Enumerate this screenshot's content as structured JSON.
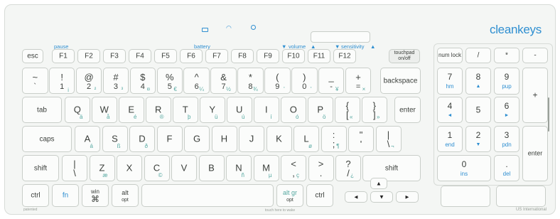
{
  "brand": "cleankeys",
  "layout_name": "US International",
  "patent_text": "patented",
  "touch_text": "touch here to wake",
  "colors": {
    "brand": "#2f8fd1",
    "accent": "#56a8a1",
    "key_face": "#fbfcfb",
    "key_border": "#c9cec9",
    "frame": "#f4f6f4"
  },
  "indicators": {
    "icons": [
      "battery-indicator-icon",
      "wifi-indicator-icon",
      "power-indicator-icon"
    ]
  },
  "function_labels": {
    "pause": "pause",
    "battery": "battery",
    "volume": "volume",
    "sensitivity": "sensitivity"
  },
  "function_row": {
    "esc": "esc",
    "f": [
      "F1",
      "F2",
      "F3",
      "F4",
      "F5",
      "F6",
      "F7",
      "F8",
      "F9",
      "F10",
      "F11",
      "F12"
    ],
    "touchpad": "touchpad on/off"
  },
  "number_row": [
    {
      "top": "~",
      "bot": "`",
      "acc": ""
    },
    {
      "top": "!",
      "bot": "1",
      "acc": "¡"
    },
    {
      "top": "@",
      "bot": "2",
      "acc": "²"
    },
    {
      "top": "#",
      "bot": "3",
      "acc": "³"
    },
    {
      "top": "$",
      "bot": "4",
      "acc": "¤"
    },
    {
      "top": "%",
      "bot": "5",
      "acc": "€"
    },
    {
      "top": "^",
      "bot": "6",
      "acc": "¼"
    },
    {
      "top": "&",
      "bot": "7",
      "acc": "½"
    },
    {
      "top": "*",
      "bot": "8",
      "acc": "¾"
    },
    {
      "top": "(",
      "bot": "9",
      "acc": "'"
    },
    {
      "top": ")",
      "bot": "0",
      "acc": "'"
    },
    {
      "top": "_",
      "bot": "-",
      "acc": "¥"
    },
    {
      "top": "+",
      "bot": "=",
      "acc": "×"
    }
  ],
  "backspace": "backspace",
  "tab": "tab",
  "qwerty_row": [
    {
      "k": "Q",
      "acc": "ä"
    },
    {
      "k": "W",
      "acc": "å"
    },
    {
      "k": "E",
      "acc": "é"
    },
    {
      "k": "R",
      "acc": "®"
    },
    {
      "k": "T",
      "acc": "þ"
    },
    {
      "k": "Y",
      "acc": "ü"
    },
    {
      "k": "U",
      "acc": "ú"
    },
    {
      "k": "I",
      "acc": "í"
    },
    {
      "k": "O",
      "acc": "ó"
    },
    {
      "k": "P",
      "acc": "ö"
    },
    {
      "top": "{",
      "bot": "[",
      "acc": "«"
    },
    {
      "top": "}",
      "bot": "]",
      "acc": "»"
    }
  ],
  "enter": "enter",
  "caps": "caps",
  "home_row": [
    {
      "k": "A",
      "acc": "á"
    },
    {
      "k": "S",
      "acc": "ß"
    },
    {
      "k": "D",
      "acc": "ð"
    },
    {
      "k": "F",
      "acc": ""
    },
    {
      "k": "G",
      "acc": ""
    },
    {
      "k": "H",
      "acc": ""
    },
    {
      "k": "J",
      "acc": ""
    },
    {
      "k": "K",
      "acc": ""
    },
    {
      "k": "L",
      "acc": "ø"
    },
    {
      "top": ":",
      "bot": ";",
      "acc": "¶"
    },
    {
      "top": "\"",
      "bot": "'",
      "acc": ""
    },
    {
      "top": "|",
      "bot": "\\",
      "acc": "¬"
    }
  ],
  "shift": "shift",
  "bottom_row": [
    {
      "top": "|",
      "bot": "\\",
      "acc": ""
    },
    {
      "k": "Z",
      "acc": "æ"
    },
    {
      "k": "X",
      "acc": ""
    },
    {
      "k": "C",
      "acc": "©"
    },
    {
      "k": "V",
      "acc": ""
    },
    {
      "k": "B",
      "acc": ""
    },
    {
      "k": "N",
      "acc": "ñ"
    },
    {
      "k": "M",
      "acc": "µ"
    },
    {
      "top": "<",
      "bot": ",",
      "acc": "ç"
    },
    {
      "top": ">",
      "bot": ".",
      "acc": ""
    },
    {
      "top": "?",
      "bot": "/",
      "acc": "¿"
    }
  ],
  "space_row": {
    "ctrl": "ctrl",
    "fn": "fn",
    "win": "win",
    "cmd": "⌘",
    "alt": "alt",
    "opt": "opt",
    "altgr": "alt gr",
    "ctrl_r": "ctrl"
  },
  "arrows": {
    "up": "▲",
    "left": "◄",
    "down": "▼",
    "right": "►"
  },
  "numpad": {
    "numlock": "num lock",
    "slash": "/",
    "star": "*",
    "minus": "-",
    "plus": "+",
    "enter": "enter",
    "k7": "7",
    "k7s": "hm",
    "k8": "8",
    "k8s": "▲",
    "k9": "9",
    "k9s": "pup",
    "k4": "4",
    "k4s": "◄",
    "k5": "5",
    "k6": "6",
    "k6s": "►",
    "k1": "1",
    "k1s": "end",
    "k2": "2",
    "k2s": "▼",
    "k3": "3",
    "k3s": "pdn",
    "k0": "0",
    "k0s": "ins",
    "kdot": ".",
    "kdots": "del"
  }
}
